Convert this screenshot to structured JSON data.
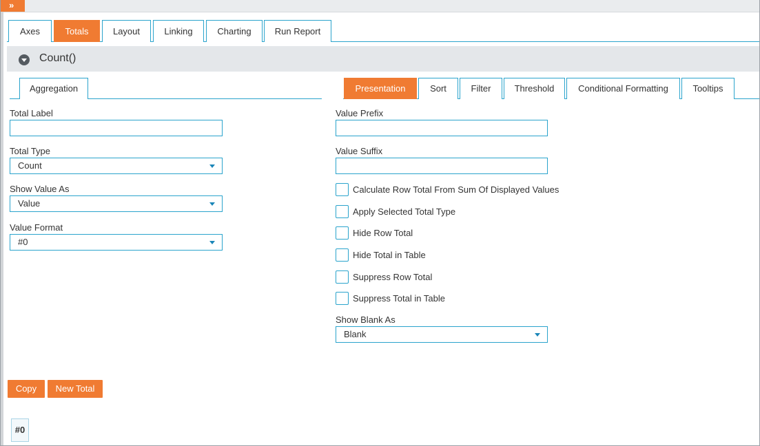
{
  "topbar": {
    "expand_glyph": "»"
  },
  "main_tabs": [
    {
      "label": "Axes"
    },
    {
      "label": "Totals",
      "active": true
    },
    {
      "label": "Layout"
    },
    {
      "label": "Linking"
    },
    {
      "label": "Charting"
    },
    {
      "label": "Run Report"
    }
  ],
  "section": {
    "title": "Count()",
    "icon": "collapse-icon"
  },
  "left_tabs": [
    {
      "label": "Aggregation"
    }
  ],
  "right_tabs": [
    {
      "label": "Presentation",
      "active": true
    },
    {
      "label": "Sort"
    },
    {
      "label": "Filter"
    },
    {
      "label": "Threshold"
    },
    {
      "label": "Conditional Formatting"
    },
    {
      "label": "Tooltips"
    }
  ],
  "left_form": {
    "total_label": {
      "label": "Total Label",
      "value": ""
    },
    "total_type": {
      "label": "Total Type",
      "value": "Count"
    },
    "show_value_as": {
      "label": "Show Value As",
      "value": "Value"
    },
    "value_format": {
      "label": "Value Format",
      "value": "#0"
    }
  },
  "right_form": {
    "value_prefix": {
      "label": "Value Prefix",
      "value": ""
    },
    "value_suffix": {
      "label": "Value Suffix",
      "value": ""
    },
    "checkboxes": [
      {
        "label": "Calculate Row Total From Sum Of Displayed Values",
        "checked": false
      },
      {
        "label": "Apply Selected Total Type",
        "checked": false
      },
      {
        "label": "Hide Row Total",
        "checked": false
      },
      {
        "label": "Hide Total in Table",
        "checked": false
      },
      {
        "label": "Suppress Row Total",
        "checked": false
      },
      {
        "label": "Suppress Total in Table",
        "checked": false
      }
    ],
    "show_blank_as": {
      "label": "Show Blank As",
      "value": "Blank"
    }
  },
  "buttons": {
    "copy": "Copy",
    "new_total": "New Total"
  },
  "format_preview": "#0",
  "colors": {
    "accent": "#f07b32",
    "border": "#29a3cc",
    "header_bg": "#e4e7ea"
  }
}
